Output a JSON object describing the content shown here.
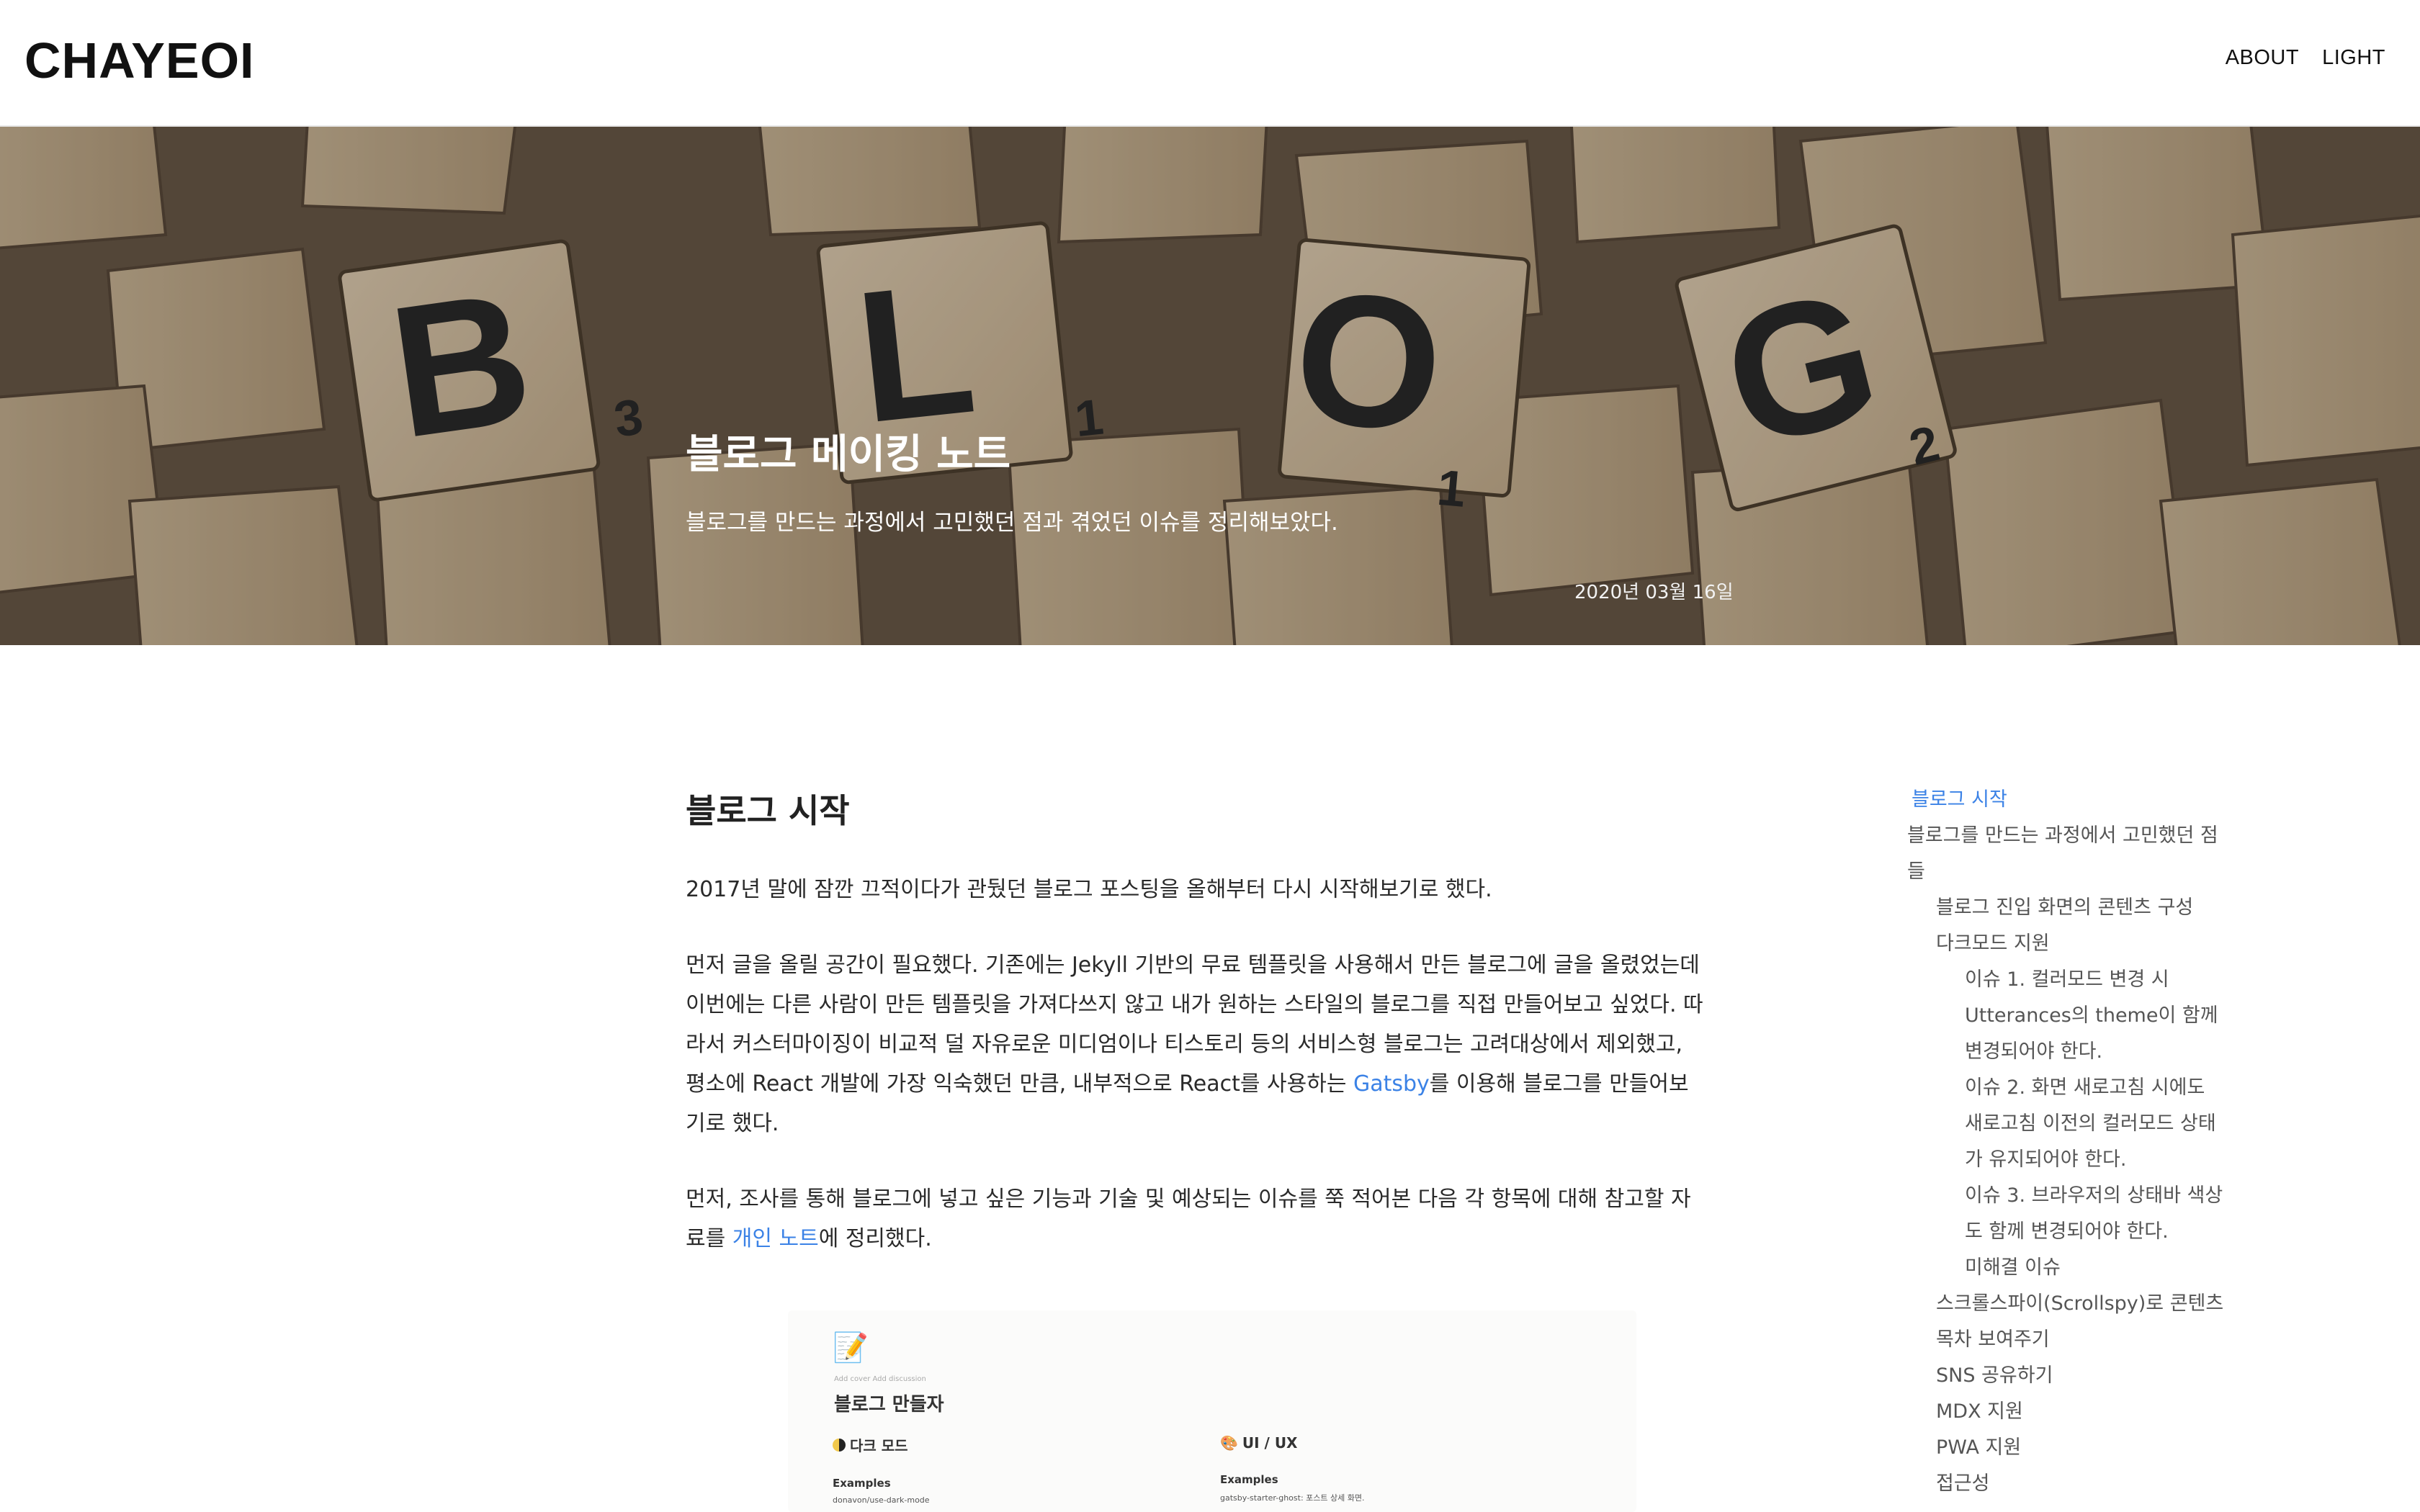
{
  "header": {
    "logo": "CHAYEOI",
    "nav": {
      "about": "ABOUT",
      "theme": "LIGHT"
    }
  },
  "hero": {
    "title": "블로그 메이킹 노트",
    "subtitle": "블로그를 만드는 과정에서 고민했던 점과 겪었던 이슈를 정리해보았다.",
    "date": "2020년 03월 16일",
    "tiles": [
      {
        "letter": "B",
        "score": "3"
      },
      {
        "letter": "L",
        "score": "1"
      },
      {
        "letter": "O",
        "score": "1"
      },
      {
        "letter": "G",
        "score": "2"
      }
    ]
  },
  "article": {
    "heading": "블로그 시작",
    "p1": "2017년 말에 잠깐 끄적이다가 관뒀던 블로그 포스팅을 올해부터 다시 시작해보기로 했다.",
    "p2_before": "먼저 글을 올릴 공간이 필요했다. 기존에는 Jekyll 기반의 무료 템플릿을 사용해서 만든 블로그에 글을 올렸었는데 이번에는 다른 사람이 만든 템플릿을 가져다쓰지 않고 내가 원하는 스타일의 블로그를 직접 만들어보고 싶었다. 따라서 커스터마이징이 비교적 덜 자유로운 미디엄이나 티스토리 등의 서비스형 블로그는 고려대상에서 제외했고, 평소에 React 개발에 가장 익숙했던 만큼, 내부적으로 React를 사용하는 ",
    "p2_link": "Gatsby",
    "p2_after": "를 이용해 블로그를 만들어보기로 했다.",
    "p3_before": "먼저, 조사를 통해 블로그에 넣고 싶은 기능과 기술 및 예상되는 이슈를 쭉 적어본 다음 각 항목에 대해 참고할 자료를 ",
    "p3_link": "개인 노트",
    "p3_after": "에 정리했다."
  },
  "notion": {
    "icon": "📝",
    "meta": "Add cover   Add discussion",
    "title": "블로그 만들자",
    "col1": {
      "head": "다크 모드",
      "sub": "Examples",
      "item": "donavon/use-dark-mode"
    },
    "col2": {
      "head": "UI / UX",
      "sub": "Examples",
      "item": "gatsby-starter-ghost: 포스트 상세 화면."
    }
  },
  "toc": [
    {
      "label": "블로그 시작",
      "level": 0,
      "active": true
    },
    {
      "label": "블로그를 만드는 과정에서 고민했던 점들",
      "level": 0
    },
    {
      "label": "블로그 진입 화면의 콘텐츠 구성",
      "level": 1
    },
    {
      "label": "다크모드 지원",
      "level": 1
    },
    {
      "label": "이슈 1. 컬러모드 변경 시 Utterances의 theme이 함께 변경되어야 한다.",
      "level": 2
    },
    {
      "label": "이슈 2. 화면 새로고침 시에도 새로고침 이전의 컬러모드 상태가 유지되어야 한다.",
      "level": 2
    },
    {
      "label": "이슈 3. 브라우저의 상태바 색상도 함께 변경되어야 한다.",
      "level": 2
    },
    {
      "label": "미해결 이슈",
      "level": 2
    },
    {
      "label": "스크롤스파이(Scrollspy)로 콘텐츠 목차 보여주기",
      "level": 1
    },
    {
      "label": "SNS 공유하기",
      "level": 1
    },
    {
      "label": "MDX 지원",
      "level": 1
    },
    {
      "label": "PWA 지원",
      "level": 1
    },
    {
      "label": "접근성",
      "level": 1
    }
  ],
  "colors": {
    "accent": "#3b82e6",
    "tile": "#d8c3a5",
    "tile_text": "#2b2b2b"
  }
}
